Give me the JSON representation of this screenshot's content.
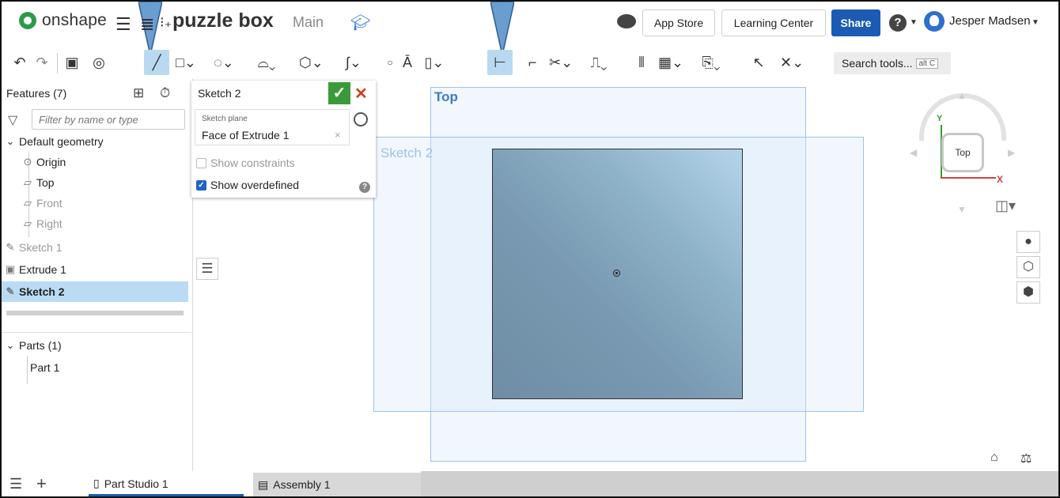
{
  "app": {
    "logo_text": "onshape",
    "document_title": "puzzle box",
    "branch": "Main",
    "user_name": "Jesper Madsen"
  },
  "header": {
    "app_store": "App Store",
    "learning_center": "Learning Center",
    "share": "Share"
  },
  "toolbar": {
    "search_placeholder": "Search tools...",
    "search_shortcut": "alt C",
    "active_tool": "line-tool"
  },
  "features_panel": {
    "title": "Features (7)",
    "filter_placeholder": "Filter by name or type",
    "default_geometry": "Default geometry",
    "items": [
      {
        "label": "Origin"
      },
      {
        "label": "Top"
      },
      {
        "label": "Front"
      },
      {
        "label": "Right"
      },
      {
        "label": "Sketch 1"
      },
      {
        "label": "Extrude 1"
      },
      {
        "label": "Sketch 2"
      }
    ],
    "parts_header": "Parts (1)",
    "parts": [
      "Part 1"
    ]
  },
  "sketch_dialog": {
    "title": "Sketch 2",
    "plane_label": "Sketch plane",
    "plane_value": "Face of Extrude 1",
    "show_constraints": "Show constraints",
    "show_constraints_checked": false,
    "show_overdefined": "Show overdefined",
    "show_overdefined_checked": true
  },
  "viewport": {
    "top_plane_label": "Top",
    "sketch_plane_label": "Sketch 2",
    "viewcube_face": "Top",
    "axis_x": "X",
    "axis_y": "Y"
  },
  "tabs": [
    {
      "label": "Part Studio 1",
      "active": true
    },
    {
      "label": "Assembly 1",
      "active": false
    }
  ],
  "colors": {
    "accent": "#1b5bb3",
    "active_tool_bg": "#b9d9f1",
    "selected_feature_bg": "#b9dcf4",
    "ok_green": "#3a9a3a",
    "cancel_red": "#d04020"
  }
}
